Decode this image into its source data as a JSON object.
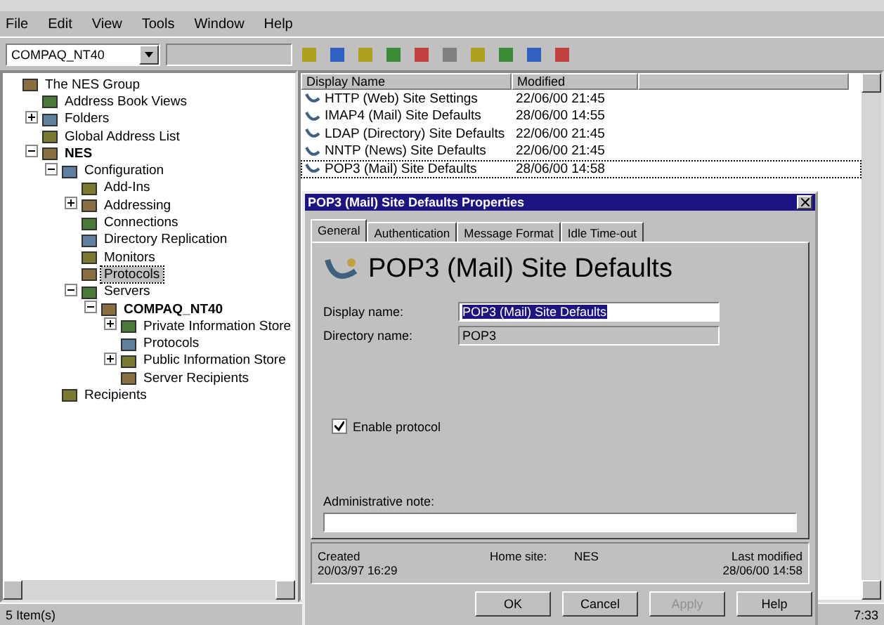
{
  "menu": [
    "File",
    "Edit",
    "View",
    "Tools",
    "Window",
    "Help"
  ],
  "toolbar": {
    "server": "COMPAQ_NT40"
  },
  "tree": [
    {
      "label": "The NES Group",
      "bold": false,
      "selected": false,
      "children": [
        {
          "label": "Address Book Views",
          "bold": false,
          "selected": false
        },
        {
          "label": "Folders",
          "bold": false,
          "selected": false,
          "expanded": false
        },
        {
          "label": "Global Address List",
          "bold": false,
          "selected": false
        },
        {
          "label": "NES",
          "bold": true,
          "selected": false,
          "expanded": true,
          "children": [
            {
              "label": "Configuration",
              "bold": false,
              "selected": false,
              "expanded": true,
              "children": [
                {
                  "label": "Add-Ins",
                  "bold": false,
                  "selected": false
                },
                {
                  "label": "Addressing",
                  "bold": false,
                  "selected": false,
                  "expanded": false
                },
                {
                  "label": "Connections",
                  "bold": false,
                  "selected": false
                },
                {
                  "label": "Directory Replication",
                  "bold": false,
                  "selected": false
                },
                {
                  "label": "Monitors",
                  "bold": false,
                  "selected": false
                },
                {
                  "label": "Protocols",
                  "bold": false,
                  "selected": true
                },
                {
                  "label": "Servers",
                  "bold": false,
                  "selected": false,
                  "expanded": true,
                  "children": [
                    {
                      "label": "COMPAQ_NT40",
                      "bold": true,
                      "selected": false,
                      "expanded": true,
                      "children": [
                        {
                          "label": "Private Information Store",
                          "bold": false,
                          "selected": false,
                          "expanded": false
                        },
                        {
                          "label": "Protocols",
                          "bold": false,
                          "selected": false
                        },
                        {
                          "label": "Public Information Store",
                          "bold": false,
                          "selected": false,
                          "expanded": false
                        },
                        {
                          "label": "Server Recipients",
                          "bold": false,
                          "selected": false
                        }
                      ]
                    }
                  ]
                }
              ]
            },
            {
              "label": "Recipients",
              "bold": false,
              "selected": false
            }
          ]
        }
      ]
    }
  ],
  "list": {
    "columns": [
      "Display Name",
      "Modified"
    ],
    "rows": [
      {
        "name": "HTTP (Web) Site Settings",
        "modified": "22/06/00 21:45",
        "selected": false
      },
      {
        "name": "IMAP4 (Mail) Site Defaults",
        "modified": "28/06/00 14:55",
        "selected": false
      },
      {
        "name": "LDAP (Directory) Site Defaults",
        "modified": "22/06/00 21:45",
        "selected": false
      },
      {
        "name": "NNTP (News) Site Defaults",
        "modified": "22/06/00 21:45",
        "selected": false
      },
      {
        "name": "POP3 (Mail) Site Defaults",
        "modified": "28/06/00 14:58",
        "selected": true
      }
    ]
  },
  "dialog": {
    "title": "POP3 (Mail) Site Defaults Properties",
    "tabs": [
      {
        "label": "General",
        "selected": true
      },
      {
        "label": "Authentication",
        "selected": false
      },
      {
        "label": "Message Format",
        "selected": false
      },
      {
        "label": "Idle Time-out",
        "selected": false
      }
    ],
    "heading": "POP3 (Mail) Site Defaults",
    "fields": [
      {
        "label": "Display name:",
        "value": "POP3 (Mail) Site Defaults",
        "disabled": false
      },
      {
        "label": "Directory name:",
        "value": "POP3",
        "disabled": true
      }
    ],
    "enable_protocol": {
      "label": "Enable protocol",
      "checked": true
    },
    "note": {
      "label": "Administrative note:"
    },
    "footer": {
      "created_label": "Created",
      "created": "20/03/97 16:29",
      "home_site_label": "Home site:",
      "home_site": "NES",
      "modified_label": "Last modified",
      "modified": "28/06/00 14:58"
    },
    "buttons": [
      {
        "label": "OK",
        "disabled": false
      },
      {
        "label": "Cancel",
        "disabled": false
      },
      {
        "label": "Apply",
        "disabled": true
      },
      {
        "label": "Help",
        "disabled": false
      }
    ]
  },
  "status_bar": {
    "left": "5 Item(s)",
    "right": "7:33"
  }
}
